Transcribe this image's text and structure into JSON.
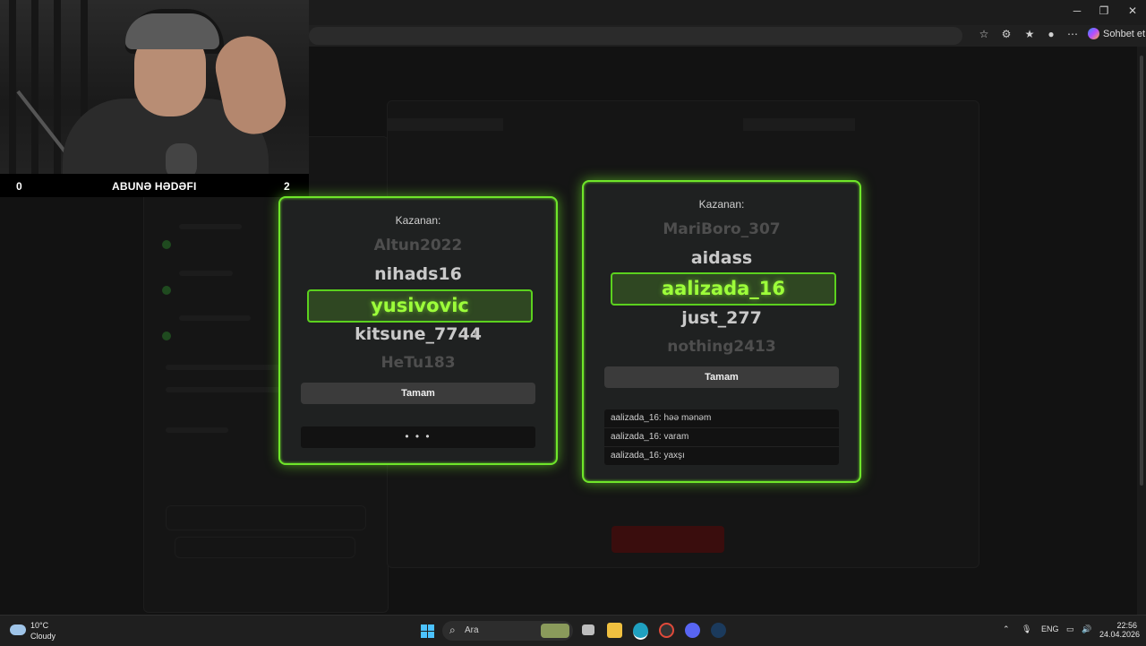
{
  "browser": {
    "copilot_label": "Sohbet et"
  },
  "stream_overlay": {
    "goal_left": "0",
    "goal_title": "ABUNƏ HƏDƏFI",
    "goal_right": "2"
  },
  "modal_left": {
    "title": "Kazanan:",
    "names_above": [
      "Altun2022",
      "nihads16"
    ],
    "winner": "yusivovic",
    "names_below": [
      "kitsune_7744",
      "HeTu183"
    ],
    "ok_label": "Tamam",
    "loading_dots": "• • •"
  },
  "modal_right": {
    "title": "Kazanan:",
    "names_above": [
      "MariBoro_307",
      "aidass"
    ],
    "winner": "aalizada_16",
    "names_below": [
      "just_277",
      "nothing2413"
    ],
    "ok_label": "Tamam",
    "chat": [
      "aalizada_16: həə mənəm",
      "aalizada_16: varam",
      "aalizada_16: yaxşı"
    ]
  },
  "taskbar": {
    "temperature": "10°C",
    "weather": "Cloudy",
    "search_placeholder": "Ara",
    "language": "ENG",
    "time": "22:56",
    "date": "24.04.2026"
  },
  "colors": {
    "accent_green": "#6fe62a",
    "winner_text": "#9dff3a"
  }
}
